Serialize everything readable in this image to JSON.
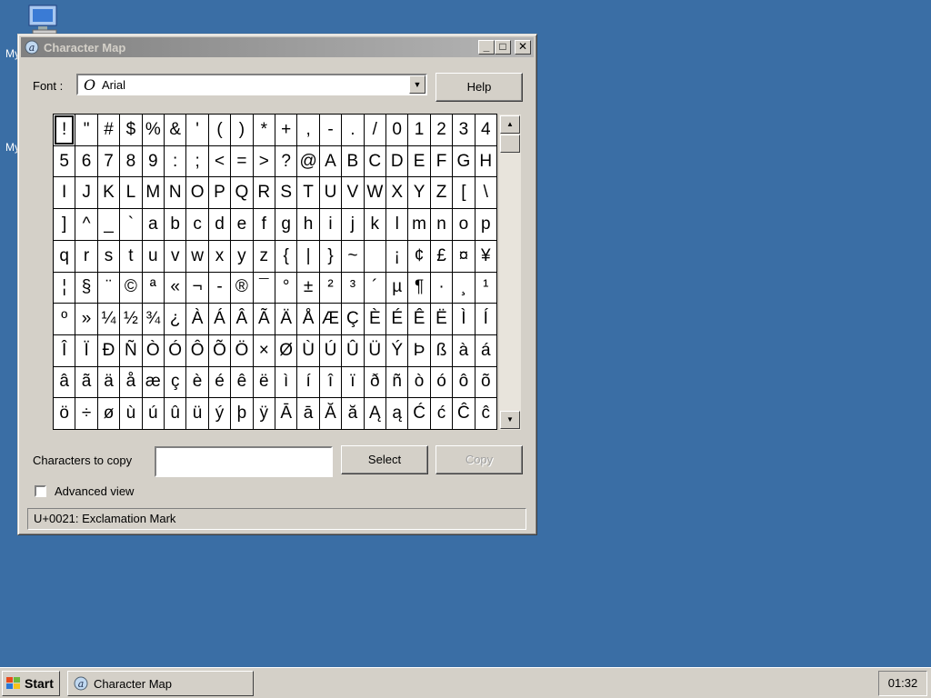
{
  "desktop": {
    "icon1_label": "My",
    "icon2_label": "My"
  },
  "window": {
    "title": "Character Map",
    "min_glyph": "_",
    "max_glyph": "□",
    "close_glyph": "✕"
  },
  "font": {
    "label": "Font :",
    "value": "Arial",
    "icon_glyph": "O",
    "dropdown_glyph": "▼"
  },
  "help_button": "Help",
  "grid": {
    "rows": [
      [
        "!",
        "\"",
        "#",
        "$",
        "%",
        "&",
        "'",
        "(",
        ")",
        "*",
        "+",
        ",",
        "-",
        ".",
        "/",
        "0",
        "1",
        "2",
        "3",
        "4"
      ],
      [
        "5",
        "6",
        "7",
        "8",
        "9",
        ":",
        ";",
        "<",
        "=",
        ">",
        "?",
        "@",
        "A",
        "B",
        "C",
        "D",
        "E",
        "F",
        "G",
        "H"
      ],
      [
        "I",
        "J",
        "K",
        "L",
        "M",
        "N",
        "O",
        "P",
        "Q",
        "R",
        "S",
        "T",
        "U",
        "V",
        "W",
        "X",
        "Y",
        "Z",
        "[",
        "\\"
      ],
      [
        "]",
        "^",
        "_",
        "`",
        "a",
        "b",
        "c",
        "d",
        "e",
        "f",
        "g",
        "h",
        "i",
        "j",
        "k",
        "l",
        "m",
        "n",
        "o",
        "p"
      ],
      [
        "q",
        "r",
        "s",
        "t",
        "u",
        "v",
        "w",
        "x",
        "y",
        "z",
        "{",
        "|",
        "}",
        "~",
        " ",
        "¡",
        "¢",
        "£",
        "¤",
        "¥"
      ],
      [
        "¦",
        "§",
        "¨",
        "©",
        "ª",
        "«",
        "¬",
        "-",
        "®",
        "¯",
        "°",
        "±",
        "²",
        "³",
        "´",
        "µ",
        "¶",
        "·",
        "¸",
        "¹"
      ],
      [
        "º",
        "»",
        "¼",
        "½",
        "¾",
        "¿",
        "À",
        "Á",
        "Â",
        "Ã",
        "Ä",
        "Å",
        "Æ",
        "Ç",
        "È",
        "É",
        "Ê",
        "Ë",
        "Ì",
        "Í"
      ],
      [
        "Î",
        "Ï",
        "Ð",
        "Ñ",
        "Ò",
        "Ó",
        "Ô",
        "Õ",
        "Ö",
        "×",
        "Ø",
        "Ù",
        "Ú",
        "Û",
        "Ü",
        "Ý",
        "Þ",
        "ß",
        "à",
        "á"
      ],
      [
        "â",
        "ã",
        "ä",
        "å",
        "æ",
        "ç",
        "è",
        "é",
        "ê",
        "ë",
        "ì",
        "í",
        "î",
        "ï",
        "ð",
        "ñ",
        "ò",
        "ó",
        "ô",
        "õ"
      ],
      [
        "ö",
        "÷",
        "ø",
        "ù",
        "ú",
        "û",
        "ü",
        "ý",
        "þ",
        "ÿ",
        "Ā",
        "ā",
        "Ă",
        "ă",
        "Ą",
        "ą",
        "Ć",
        "ć",
        "Ĉ",
        "ĉ"
      ]
    ],
    "selected": "!"
  },
  "scrollbar": {
    "up_glyph": "▲",
    "down_glyph": "▼"
  },
  "copy": {
    "label": "Characters to copy",
    "value": "",
    "select_button": "Select",
    "copy_button": "Copy"
  },
  "advanced_view": {
    "label": "Advanced view",
    "checked": false
  },
  "status": "U+0021: Exclamation Mark",
  "taskbar": {
    "start_label": "Start",
    "task_label": "Character Map",
    "clock": "01:32"
  }
}
